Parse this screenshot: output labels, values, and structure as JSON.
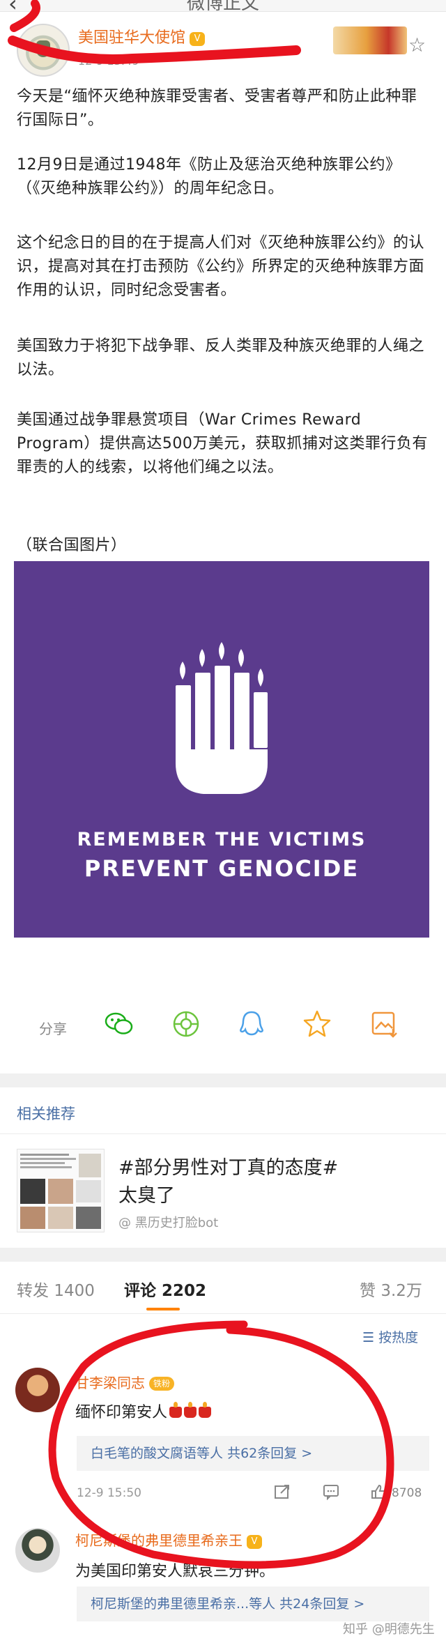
{
  "top_bar": {
    "back_icon": "back-arrow-icon",
    "title": "微博正文"
  },
  "account": {
    "name": "美国驻华大使馆",
    "badge": "V",
    "time": "12-9 15:49"
  },
  "post": {
    "paragraphs": [
      "今天是“缅怀灭绝种族罪受害者、受害者尊严和防止此种罪行国际日”。",
      "12月9日是通过1948年《防止及惩治灭绝种族罪公约》（《灭绝种族罪公约》）的周年纪念日。",
      "这个纪念日的目的在于提高人们对《灭绝种族罪公约》的认识，提高对其在打击预防《公约》所界定的灭绝种族罪方面作用的认识，同时纪念受害者。",
      "美国致力于将犯下战争罪、反人类罪及种族灭绝罪的人绳之以法。",
      "美国通过战争罪悬赏项目（War Crimes Reward Program）提供高达500万美元，获取抓捕对这类罪行负有罪责的人的线索，以将他们绳之以法。",
      "（联合国图片）"
    ],
    "image": {
      "line1": "REMEMBER THE VICTIMS",
      "line2": "PREVENT GENOCIDE",
      "bg_color": "#5b3b8d"
    }
  },
  "share": {
    "label": "分享",
    "targets": [
      "wechat-icon",
      "moments-icon",
      "qq-icon",
      "favorite-star-icon",
      "save-image-icon"
    ],
    "colors": {
      "wechat": "#1aad19",
      "moments": "#6cc43d",
      "qq": "#4aa0e8",
      "star": "#f5a623",
      "save": "#f0963c"
    }
  },
  "recommend": {
    "title": "相关推荐",
    "headline_line1": "#部分男性对丁真的态度#",
    "headline_line2": "太臭了",
    "source": "@ 黑历史打脸bot"
  },
  "tabs": {
    "repost_label": "转发",
    "repost_count": "1400",
    "comment_label": "评论",
    "comment_count": "2202",
    "like_label": "赞",
    "like_count": "3.2万",
    "sort_label": "按热度",
    "accent": "#ff8200"
  },
  "comments": [
    {
      "user": "甘李梁同志",
      "fan_badge": "铁粉",
      "text": "缅怀印第安人",
      "emoji": "candle-emoji",
      "reply_preview": "白毛笔的酸文腐语等人",
      "reply_count": "共62条回复 >",
      "time": "12-9 15:50",
      "likes": "8708"
    },
    {
      "user": "柯尼斯堡的弗里德里希亲王",
      "text": "为美国印第安人默哀三分钟。",
      "reply_preview": "柯尼斯堡的弗里德里希亲...等人",
      "reply_count": "共24条回复 >"
    }
  ],
  "watermark": "知乎 @明德先生",
  "annotation_color": "#e8131f",
  "link_color": "#4a6fa5",
  "username_color": "#e86b1d"
}
